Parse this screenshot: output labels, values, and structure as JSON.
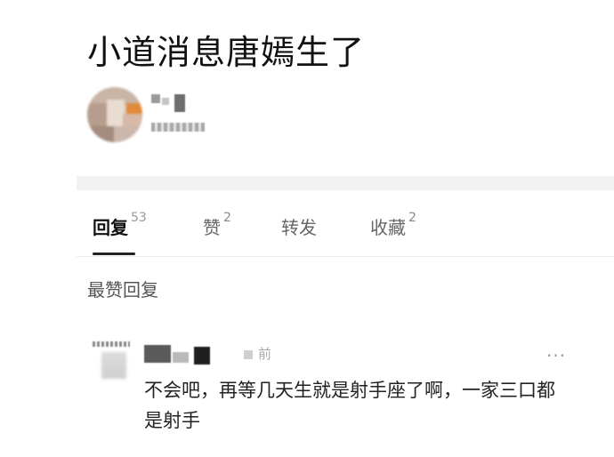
{
  "post": {
    "title": "小道消息唐嫣生了"
  },
  "tabs": [
    {
      "label": "回复",
      "count": "53"
    },
    {
      "label": "赞",
      "count": "2"
    },
    {
      "label": "转发",
      "count": ""
    },
    {
      "label": "收藏",
      "count": "2"
    }
  ],
  "section_label": "最赞回复",
  "comment": {
    "time_suffix": "前",
    "more_icon": "···",
    "text": "不会吧，再等几天生就是射手座了啊，一家三口都是射手"
  },
  "colors": {
    "accent": "#222222",
    "divider": "#f2f2f2"
  },
  "icons": {
    "more": "more-horizontal-icon"
  }
}
